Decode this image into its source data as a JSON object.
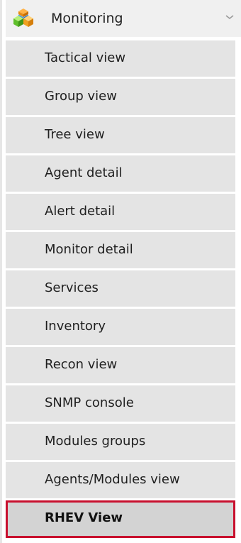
{
  "menu": {
    "header": {
      "title": "Monitoring",
      "icon": "cube-stack-icon",
      "chevron_icon": "chevron-down-icon"
    },
    "items": [
      {
        "label": "Tactical view"
      },
      {
        "label": "Group view"
      },
      {
        "label": "Tree view"
      },
      {
        "label": "Agent detail"
      },
      {
        "label": "Alert detail"
      },
      {
        "label": "Monitor detail"
      },
      {
        "label": "Services"
      },
      {
        "label": "Inventory"
      },
      {
        "label": "Recon view"
      },
      {
        "label": "SNMP console"
      },
      {
        "label": "Modules groups"
      },
      {
        "label": "Agents/Modules view"
      },
      {
        "label": "RHEV View",
        "active": true
      }
    ]
  },
  "colors": {
    "item_bg": "#e4e4e4",
    "active_bg": "#d3d3d3",
    "active_border": "#c8102e",
    "header_bg": "#f0f0f0",
    "text": "#1f1f1f"
  }
}
